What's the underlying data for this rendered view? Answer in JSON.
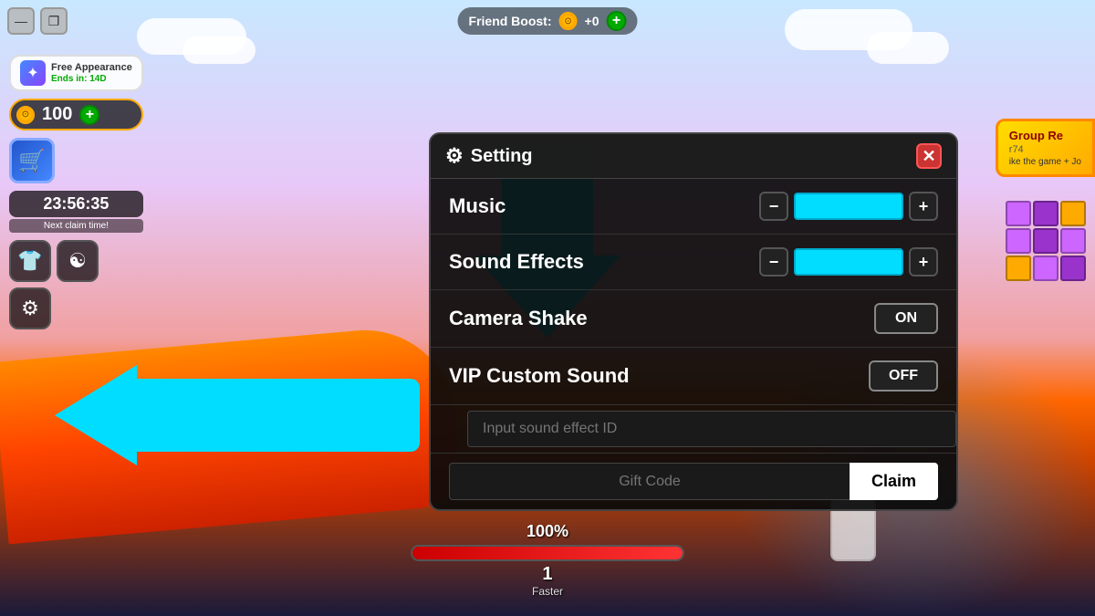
{
  "background": {
    "sky_color": "#c8e8ff",
    "ground_color": "#ff6600"
  },
  "top_hud": {
    "friend_boost_label": "Friend Boost:",
    "friend_boost_value": "+0",
    "add_label": "+"
  },
  "window_controls": {
    "minimize_icon": "—",
    "restore_icon": "❐"
  },
  "left_hud": {
    "free_appearance": {
      "label": "Free Appearance",
      "sub": "Ends in: 14D"
    },
    "coins": {
      "value": "100",
      "add_label": "+"
    },
    "cart_icon": "🛒",
    "timer": "23:56:35",
    "timer_sub": "Next claim time!",
    "shirt_icon": "👕",
    "swirl_icon": "☯",
    "settings_icon": "⚙"
  },
  "group_reward": {
    "title": "Group Re",
    "sub": "ike the game + Jo",
    "suffix": "r74"
  },
  "settings_modal": {
    "title": "Setting",
    "gear_icon": "⚙",
    "close_icon": "✕",
    "rows": [
      {
        "label": "Music",
        "control": "slider",
        "minus": "−",
        "plus": "+"
      },
      {
        "label": "Sound Effects",
        "control": "slider",
        "minus": "−",
        "plus": "+"
      },
      {
        "label": "Camera Shake",
        "control": "toggle",
        "value": "ON"
      },
      {
        "label": "VIP Custom Sound",
        "control": "toggle",
        "value": "OFF"
      }
    ],
    "sound_placeholder": "Input sound effect ID",
    "gift_placeholder": "Gift Code",
    "claim_label": "Claim"
  },
  "progress": {
    "label": "100%",
    "fill_percent": 100
  },
  "counter": {
    "number": "1",
    "label": "Faster"
  },
  "arrows": {
    "down_color": "#00ddff",
    "left_color": "#00ddff"
  }
}
